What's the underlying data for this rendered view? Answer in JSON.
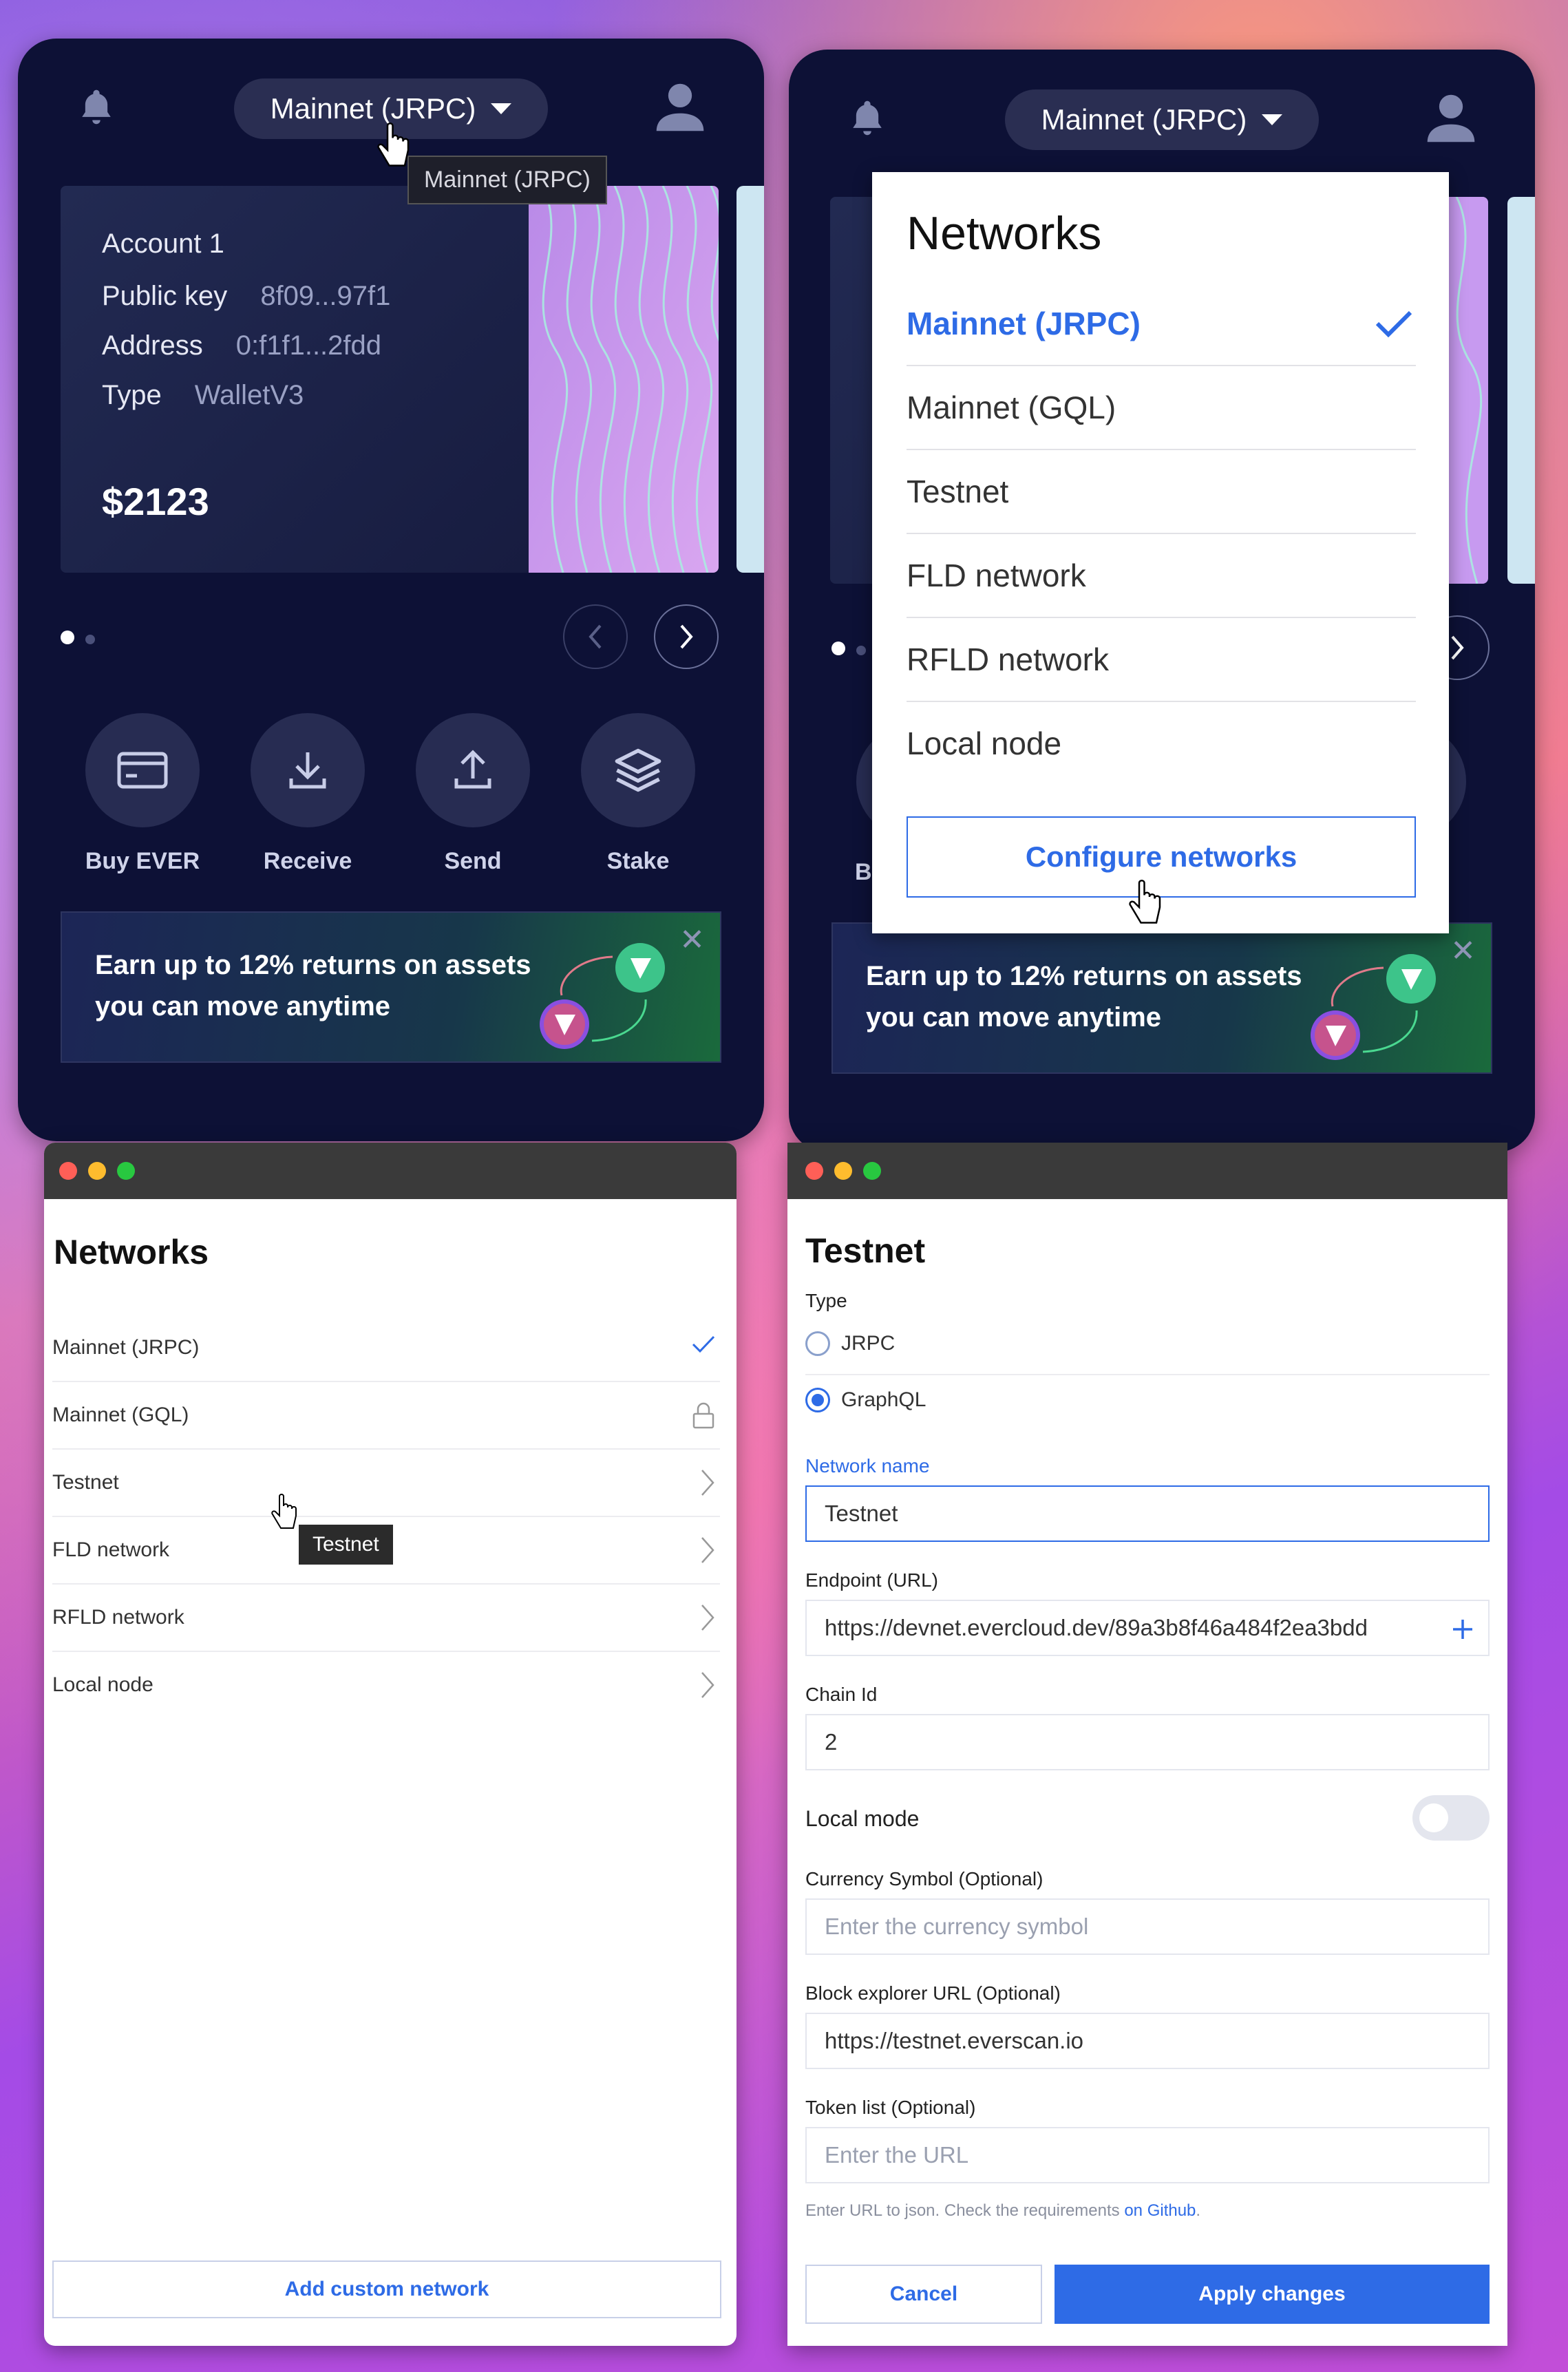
{
  "wallet_left": {
    "network": "Mainnet (JRPC)",
    "tooltip": "Mainnet (JRPC)",
    "account": {
      "name": "Account 1",
      "public_key_label": "Public key",
      "public_key": "8f09...97f1",
      "address_label": "Address",
      "address": "0:f1f1...2fdd",
      "type_label": "Type",
      "type": "WalletV3",
      "balance": "$2123"
    },
    "actions": [
      "Buy EVER",
      "Receive",
      "Send",
      "Stake"
    ],
    "promo": "Earn up to 12% returns on assets you can move anytime",
    "close_glyph": "✕"
  },
  "wallet_right": {
    "network": "Mainnet (JRPC)",
    "behind_label": "B",
    "promo": "Earn up to 12% returns on assets you can move anytime",
    "close_glyph": "✕",
    "dropdown": {
      "title": "Networks",
      "items": [
        "Mainnet (JRPC)",
        "Mainnet (GQL)",
        "Testnet",
        "FLD network",
        "RFLD network",
        "Local node"
      ],
      "selected": "Mainnet (JRPC)",
      "configure_button": "Configure networks"
    }
  },
  "networks_window": {
    "title": "Networks",
    "items": [
      {
        "label": "Mainnet (JRPC)",
        "icon": "check-icon"
      },
      {
        "label": "Mainnet (GQL)",
        "icon": "lock-icon"
      },
      {
        "label": "Testnet",
        "icon": "chevron-right-icon"
      },
      {
        "label": "FLD network",
        "icon": "chevron-right-icon"
      },
      {
        "label": "RFLD network",
        "icon": "chevron-right-icon"
      },
      {
        "label": "Local node",
        "icon": "chevron-right-icon"
      }
    ],
    "tooltip": "Testnet",
    "add_button": "Add custom network"
  },
  "edit_window": {
    "title": "Testnet",
    "type_label": "Type",
    "types": [
      "JRPC",
      "GraphQL"
    ],
    "selected_type": "GraphQL",
    "network_name_label": "Network name",
    "network_name": "Testnet",
    "endpoint_label": "Endpoint (URL)",
    "endpoint": "https://devnet.evercloud.dev/89a3b8f46a484f2ea3bdd",
    "chain_id_label": "Chain Id",
    "chain_id": "2",
    "local_mode_label": "Local mode",
    "local_mode": false,
    "currency_label": "Currency Symbol (Optional)",
    "currency_placeholder": "Enter the currency symbol",
    "explorer_label": "Block explorer URL (Optional)",
    "explorer": "https://testnet.everscan.io",
    "token_list_label": "Token list (Optional)",
    "token_list_placeholder": "Enter the URL",
    "hint_text": "Enter URL to json. Check the requirements ",
    "hint_link": "on Github",
    "hint_end": ".",
    "cancel_button": "Cancel",
    "apply_button": "Apply changes"
  },
  "colors": {
    "panel": "#0d1136",
    "accent": "#2e6be6",
    "traffic_red": "#ff5f57",
    "traffic_yellow": "#febc2e",
    "traffic_green": "#28c840"
  }
}
